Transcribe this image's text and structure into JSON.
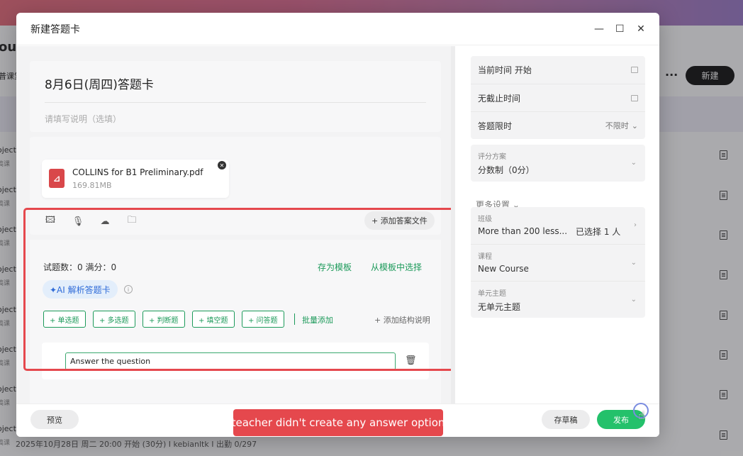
{
  "background": {
    "title": "our",
    "tab": "普课堂",
    "new_button": "新建",
    "more": "···",
    "rows": [
      "oject",
      "oject",
      "oject",
      "oject",
      "oject",
      "oject",
      "oject",
      "oject"
    ],
    "row_sub": "搞课",
    "footer": "2025年10月28日 周二 20:00 开始 (30分) I kebianltk I 出勤 0/297"
  },
  "modal": {
    "title": "新建答题卡",
    "exam_title": "8月6日(周四)答题卡",
    "description_placeholder": "请填写说明（选填）",
    "file": {
      "name": "COLLINS for B1 Preliminary.pdf",
      "size": "169.81MB"
    },
    "add_answer_file": "+ 添加答案文件",
    "questions": {
      "stats": "试题数：0   满分：0",
      "save_template": "存为模板",
      "from_template": "从模板中选择",
      "ai_parse": "✦AI 解析答题卡",
      "types": [
        "+ 单选题",
        "+ 多选题",
        "+ 判断题",
        "+ 填空题",
        "+ 问答题"
      ],
      "batch_add": "批量添加",
      "add_structure": "+ 添加结构说明",
      "question_text": "Answer the question"
    },
    "settings": {
      "start_time": "当前时间 开始",
      "end_time": "无截止时间",
      "time_limit_label": "答题限时",
      "time_limit_value": "不限时",
      "scoring_label": "评分方案",
      "scoring_value": "分数制（0分）",
      "more_settings": "更多设置 ⌄",
      "class_label": "班级",
      "class_value": "More than 200 less...",
      "class_selected": "已选择 1 人",
      "course_label": "课程",
      "course_value": "New Course",
      "unit_label": "单元主题",
      "unit_value": "无单元主题"
    },
    "footer": {
      "preview": "预览",
      "draft": "存草稿",
      "publish": "发布"
    }
  },
  "annotation": "teacher didn't create any answer option",
  "colors": {
    "accent_green": "#1c9a5a",
    "publish_green": "#24c16b",
    "annotation_red": "#e5484d"
  }
}
